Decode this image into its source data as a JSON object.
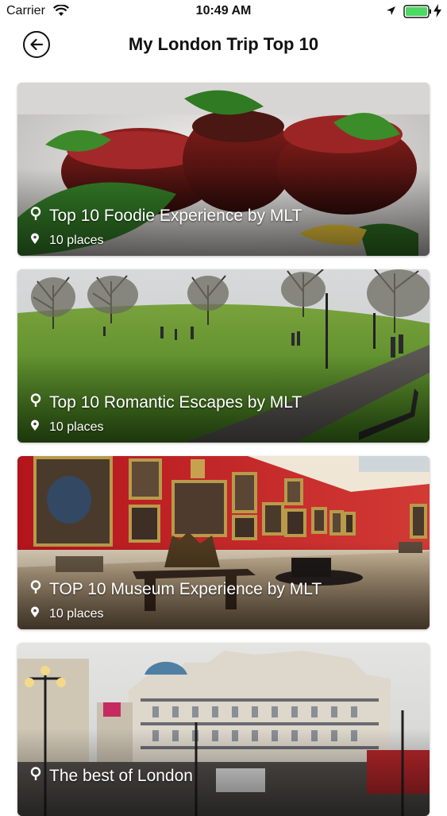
{
  "status_bar": {
    "carrier": "Carrier",
    "time": "10:49 AM"
  },
  "header": {
    "title": "My London Trip Top 10",
    "back_icon": "arrow-left-circle-icon"
  },
  "lists": [
    {
      "title": "Top 10 Foodie Experience by MLT",
      "count": "10 places",
      "icon": "map-pin-icon"
    },
    {
      "title": "Top 10 Romantic Escapes by MLT",
      "count": "10 places",
      "icon": "map-pin-icon"
    },
    {
      "title": "TOP 10 Museum Experience by MLT",
      "count": "10 places",
      "icon": "map-pin-icon"
    },
    {
      "title": "The best of London",
      "count": "",
      "icon": "map-pin-icon"
    }
  ]
}
